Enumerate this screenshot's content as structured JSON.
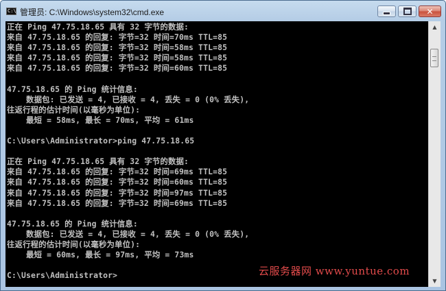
{
  "window": {
    "title": "管理员: C:\\Windows\\system32\\cmd.exe",
    "icon_text": "C:\\",
    "buttons": {
      "minimize_icon": "minimize-icon",
      "maximize_icon": "maximize-icon",
      "close_icon": "close-icon",
      "close_glyph": "✕"
    }
  },
  "console": {
    "lines": [
      "正在 Ping 47.75.18.65 具有 32 字节的数据:",
      "来自 47.75.18.65 的回复: 字节=32 时间=70ms TTL=85",
      "来自 47.75.18.65 的回复: 字节=32 时间=58ms TTL=85",
      "来自 47.75.18.65 的回复: 字节=32 时间=58ms TTL=85",
      "来自 47.75.18.65 的回复: 字节=32 时间=60ms TTL=85",
      "",
      "47.75.18.65 的 Ping 统计信息:",
      "    数据包: 已发送 = 4, 已接收 = 4, 丢失 = 0 (0% 丢失),",
      "往返行程的估计时间(以毫秒为单位):",
      "    最短 = 58ms, 最长 = 70ms, 平均 = 61ms",
      "",
      "C:\\Users\\Administrator>ping 47.75.18.65",
      "",
      "正在 Ping 47.75.18.65 具有 32 字节的数据:",
      "来自 47.75.18.65 的回复: 字节=32 时间=69ms TTL=85",
      "来自 47.75.18.65 的回复: 字节=32 时间=60ms TTL=85",
      "来自 47.75.18.65 的回复: 字节=32 时间=97ms TTL=85",
      "来自 47.75.18.65 的回复: 字节=32 时间=69ms TTL=85",
      "",
      "47.75.18.65 的 Ping 统计信息:",
      "    数据包: 已发送 = 4, 已接收 = 4, 丢失 = 0 (0% 丢失),",
      "往返行程的估计时间(以毫秒为单位):",
      "    最短 = 60ms, 最长 = 97ms, 平均 = 73ms",
      "",
      "C:\\Users\\Administrator>"
    ]
  },
  "scrollbar": {
    "up_arrow": "▲",
    "down_arrow": "▼"
  },
  "watermark": "云服务器网 www.yuntue.com"
}
